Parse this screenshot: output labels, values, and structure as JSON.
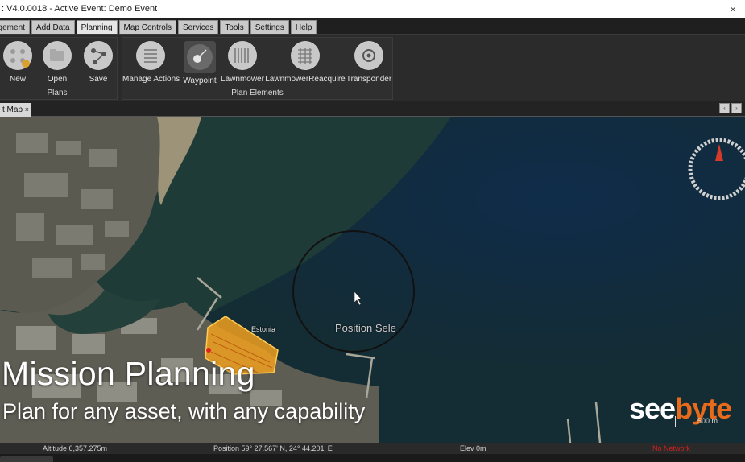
{
  "window": {
    "title": ": V4.0.0018 - Active Event: Demo Event",
    "close_glyph": "×"
  },
  "menu": {
    "tabs": [
      "agement",
      "Add Data",
      "Planning",
      "Map Controls",
      "Services",
      "Tools",
      "Settings",
      "Help"
    ],
    "active": "Planning"
  },
  "ribbon": {
    "plans": {
      "title": "Plans",
      "buttons": [
        {
          "label": "New",
          "icon": "new-plan-icon"
        },
        {
          "label": "Open",
          "icon": "open-plan-icon"
        },
        {
          "label": "Save",
          "icon": "save-plan-icon"
        }
      ]
    },
    "plan_elements": {
      "title": "Plan Elements",
      "buttons": [
        {
          "label": "Manage Actions",
          "icon": "manage-actions-icon"
        },
        {
          "label": "Waypoint",
          "icon": "waypoint-icon"
        },
        {
          "label": "Lawnmower",
          "icon": "lawnmower-icon"
        },
        {
          "label": "LawnmowerReacquire",
          "icon": "lawnmower-reacquire-icon"
        },
        {
          "label": "Transponder",
          "icon": "transponder-icon"
        }
      ]
    }
  },
  "doc_tab": {
    "label": "t Map",
    "close": "×"
  },
  "map": {
    "place_label": "Estonia",
    "cursor_hint": "Position Sele",
    "scale_label": "500 m",
    "compass_color": "#d63a2a",
    "survey_color": "#f0a020"
  },
  "overlay": {
    "title": "Mission Planning",
    "subtitle": "Plan for any asset, with any capability",
    "brand_part1": "see",
    "brand_part2": "byte"
  },
  "status": {
    "altitude": "Altitude 6,357.275m",
    "position": "Position 59° 27.567' N, 24° 44.201' E",
    "elevation": "Elev 0m",
    "network": "No Network"
  }
}
